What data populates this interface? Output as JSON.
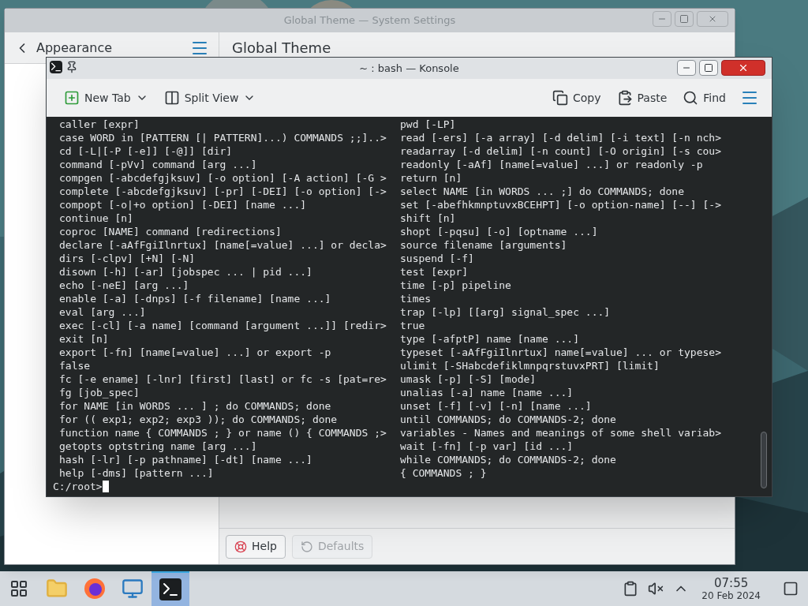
{
  "settings_window": {
    "title": "Global Theme — System Settings",
    "sidebar_title": "Appearance",
    "page_title": "Global Theme",
    "buttons": [
      {
        "label": "Help",
        "kind": "help",
        "disabled": false
      },
      {
        "label": "Defaults",
        "kind": "defaults",
        "disabled": true
      }
    ]
  },
  "konsole": {
    "title": "~ : bash — Konsole",
    "toolbar_left": [
      {
        "label": "New Tab",
        "kind": "new-tab",
        "menu": true
      },
      {
        "label": "Split View",
        "kind": "split-view",
        "menu": true
      }
    ],
    "toolbar_right": [
      {
        "label": "Copy",
        "kind": "copy",
        "menu": false
      },
      {
        "label": "Paste",
        "kind": "paste",
        "menu": false
      },
      {
        "label": "Find",
        "kind": "find",
        "menu": false
      }
    ],
    "left_column": [
      "caller [expr]",
      "case WORD in [PATTERN [| PATTERN]...) COMMANDS ;;]..>",
      "cd [-L|[-P [-e]] [-@]] [dir]",
      "command [-pVv] command [arg ...]",
      "compgen [-abcdefgjksuv] [-o option] [-A action] [-G >",
      "complete [-abcdefgjksuv] [-pr] [-DEI] [-o option] [->",
      "compopt [-o|+o option] [-DEI] [name ...]",
      "continue [n]",
      "coproc [NAME] command [redirections]",
      "declare [-aAfFgiIlnrtux] [name[=value] ...] or decla>",
      "dirs [-clpv] [+N] [-N]",
      "disown [-h] [-ar] [jobspec ... | pid ...]",
      "echo [-neE] [arg ...]",
      "enable [-a] [-dnps] [-f filename] [name ...]",
      "eval [arg ...]",
      "exec [-cl] [-a name] [command [argument ...]] [redir>",
      "exit [n]",
      "export [-fn] [name[=value] ...] or export -p",
      "false",
      "fc [-e ename] [-lnr] [first] [last] or fc -s [pat=re>",
      "fg [job_spec]",
      "for NAME [in WORDS ... ] ; do COMMANDS; done",
      "for (( exp1; exp2; exp3 )); do COMMANDS; done",
      "function name { COMMANDS ; } or name () { COMMANDS ;>",
      "getopts optstring name [arg ...]",
      "hash [-lr] [-p pathname] [-dt] [name ...]",
      "help [-dms] [pattern ...]"
    ],
    "right_column": [
      "pwd [-LP]",
      "read [-ers] [-a array] [-d delim] [-i text] [-n nch>",
      "readarray [-d delim] [-n count] [-O origin] [-s cou>",
      "readonly [-aAf] [name[=value] ...] or readonly -p",
      "return [n]",
      "select NAME [in WORDS ... ;] do COMMANDS; done",
      "set [-abefhkmnptuvxBCEHPT] [-o option-name] [--] [->",
      "shift [n]",
      "shopt [-pqsu] [-o] [optname ...]",
      "source filename [arguments]",
      "suspend [-f]",
      "test [expr]",
      "time [-p] pipeline",
      "times",
      "trap [-lp] [[arg] signal_spec ...]",
      "true",
      "type [-afptP] name [name ...]",
      "typeset [-aAfFgiIlnrtux] name[=value] ... or typese>",
      "ulimit [-SHabcdefiklmnpqrstuvxPRT] [limit]",
      "umask [-p] [-S] [mode]",
      "unalias [-a] name [name ...]",
      "unset [-f] [-v] [-n] [name ...]",
      "until COMMANDS; do COMMANDS-2; done",
      "variables - Names and meanings of some shell variab>",
      "wait [-fn] [-p var] [id ...]",
      "while COMMANDS; do COMMANDS-2; done",
      "{ COMMANDS ; }"
    ],
    "prompt": "C:/root>"
  },
  "taskbar": {
    "apps": [
      {
        "kind": "launcher",
        "selected": false
      },
      {
        "kind": "files",
        "selected": false
      },
      {
        "kind": "browser",
        "selected": false
      },
      {
        "kind": "settings",
        "selected": false
      },
      {
        "kind": "terminal",
        "selected": true
      }
    ],
    "clock": {
      "time": "07:55",
      "date": "20 Feb 2024"
    }
  }
}
